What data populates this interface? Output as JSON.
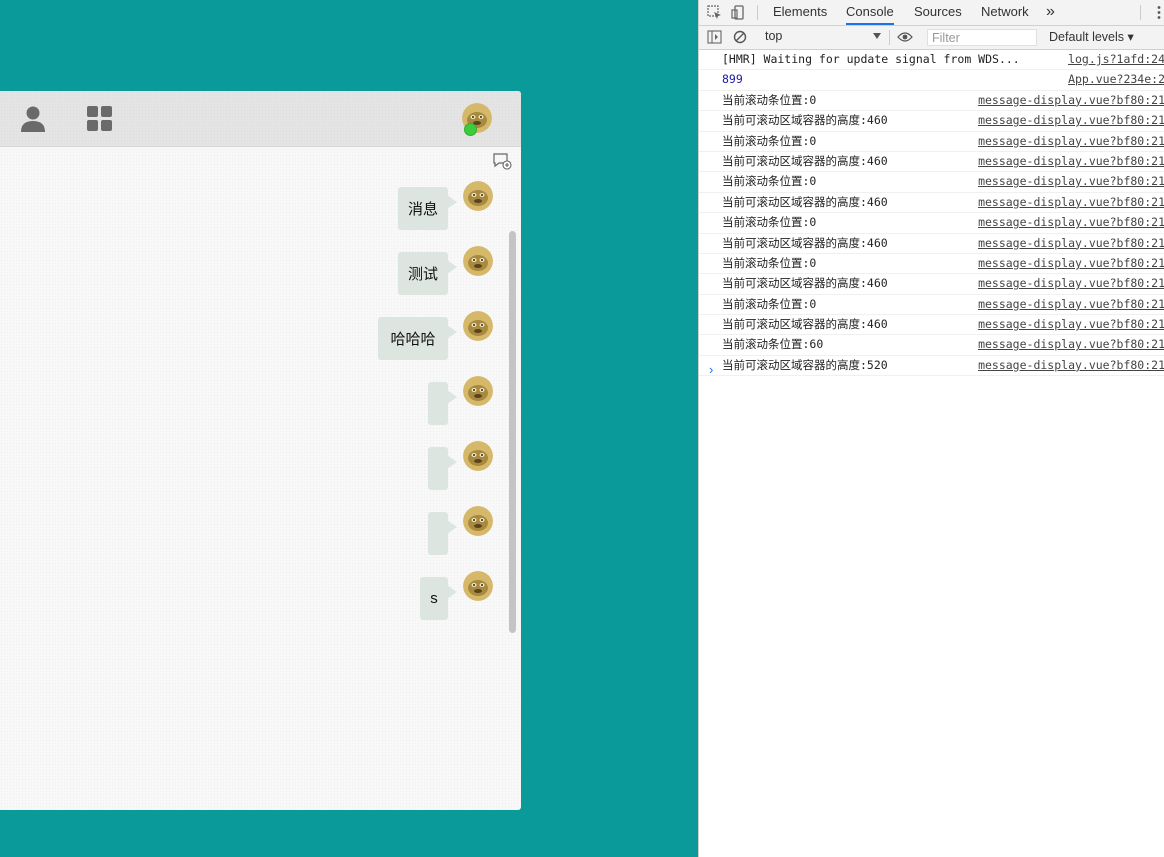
{
  "chat": {
    "messages": [
      {
        "text": "消息",
        "bubble_width": 50
      },
      {
        "text": "测试",
        "bubble_width": 50
      },
      {
        "text": "哈哈哈",
        "bubble_width": 70
      },
      {
        "text": "",
        "bubble_width": 20
      },
      {
        "text": "",
        "bubble_width": 20
      },
      {
        "text": "",
        "bubble_width": 20
      },
      {
        "text": "s",
        "bubble_width": 28
      }
    ],
    "header_icons": [
      "user-icon",
      "apps-grid-icon"
    ],
    "online_color": "#3dcc3d",
    "background_color": "#0b9a9a"
  },
  "devtools": {
    "tabs": [
      {
        "label": "Elements"
      },
      {
        "label": "Console",
        "active": true
      },
      {
        "label": "Sources"
      },
      {
        "label": "Network"
      }
    ],
    "more_tabs": "»",
    "context": "top",
    "filter_placeholder": "Filter",
    "levels": "Default levels ▾",
    "logs": [
      {
        "msg": "[HMR] Waiting for update signal from WDS...",
        "src": "log.js?1afd:24"
      },
      {
        "msg": "899",
        "src": "App.vue?234e:2",
        "num": true
      },
      {
        "msg": "当前滚动条位置:0",
        "src": "message-display.vue?bf80:21"
      },
      {
        "msg": "当前可滚动区域容器的高度:460",
        "src": "message-display.vue?bf80:21"
      },
      {
        "msg": "当前滚动条位置:0",
        "src": "message-display.vue?bf80:21"
      },
      {
        "msg": "当前可滚动区域容器的高度:460",
        "src": "message-display.vue?bf80:21"
      },
      {
        "msg": "当前滚动条位置:0",
        "src": "message-display.vue?bf80:21"
      },
      {
        "msg": "当前可滚动区域容器的高度:460",
        "src": "message-display.vue?bf80:21"
      },
      {
        "msg": "当前滚动条位置:0",
        "src": "message-display.vue?bf80:21"
      },
      {
        "msg": "当前可滚动区域容器的高度:460",
        "src": "message-display.vue?bf80:21"
      },
      {
        "msg": "当前滚动条位置:0",
        "src": "message-display.vue?bf80:21"
      },
      {
        "msg": "当前可滚动区域容器的高度:460",
        "src": "message-display.vue?bf80:21"
      },
      {
        "msg": "当前滚动条位置:0",
        "src": "message-display.vue?bf80:21"
      },
      {
        "msg": "当前可滚动区域容器的高度:460",
        "src": "message-display.vue?bf80:21"
      },
      {
        "msg": "当前滚动条位置:60",
        "src": "message-display.vue?bf80:21"
      },
      {
        "msg": "当前可滚动区域容器的高度:520",
        "src": "message-display.vue?bf80:21"
      }
    ],
    "prompt": "›"
  }
}
